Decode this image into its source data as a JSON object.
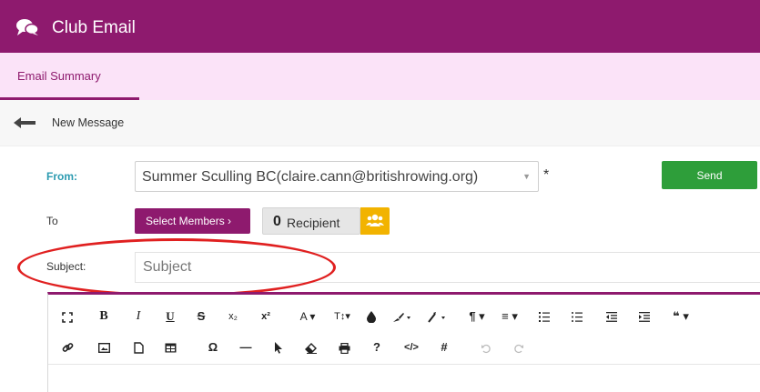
{
  "header": {
    "title": "Club Email"
  },
  "tabs": [
    {
      "label": "Email Summary"
    }
  ],
  "nav": {
    "back_label": "New Message"
  },
  "form": {
    "from_label": "From:",
    "from_value": "Summer Sculling BC(claire.cann@britishrowing.org)",
    "required_mark": "*",
    "to_label": "To",
    "select_members_label": "Select Members  ›",
    "recipient_count": "0",
    "recipient_label": "Recipient",
    "subject_label": "Subject:",
    "subject_placeholder": "Subject",
    "send_label": "Send"
  },
  "toolbar": {
    "row1": [
      "fullscreen-icon",
      "bold-icon",
      "italic-icon",
      "underline-icon",
      "strikethrough-icon",
      "subscript-icon",
      "superscript-icon",
      "font-family-icon",
      "font-size-icon",
      "text-color-icon",
      "brush-icon",
      "clear-format-icon",
      "paragraph-icon",
      "align-icon",
      "ordered-list-icon",
      "unordered-list-icon",
      "outdent-icon",
      "indent-icon",
      "quote-icon"
    ],
    "row2": [
      "link-icon",
      "image-icon",
      "file-icon",
      "table-icon",
      "special-char-icon",
      "horizontal-line-icon",
      "select-all-icon",
      "eraser-icon",
      "print-icon",
      "help-icon",
      "code-view-icon",
      "hashtag-icon",
      "undo-icon",
      "redo-icon"
    ],
    "glyphs": {
      "bold": "B",
      "italic": "I",
      "underline": "U",
      "strike": "S",
      "sub": "x₂",
      "sup": "x²",
      "font": "A ▾",
      "size": "T↕▾",
      "para": "¶ ▾",
      "align": "≡ ▾",
      "quote": "❝ ▾",
      "omega": "Ω",
      "dash": "—",
      "question": "?",
      "code": "</>",
      "hash": "#"
    }
  },
  "colors": {
    "brand": "#8e1a6e",
    "tab_bg": "#fbe3f8",
    "send": "#2e9e3a",
    "recipient_icon": "#f2b300",
    "highlight": "#e02020",
    "from_label": "#2a9ab0"
  }
}
